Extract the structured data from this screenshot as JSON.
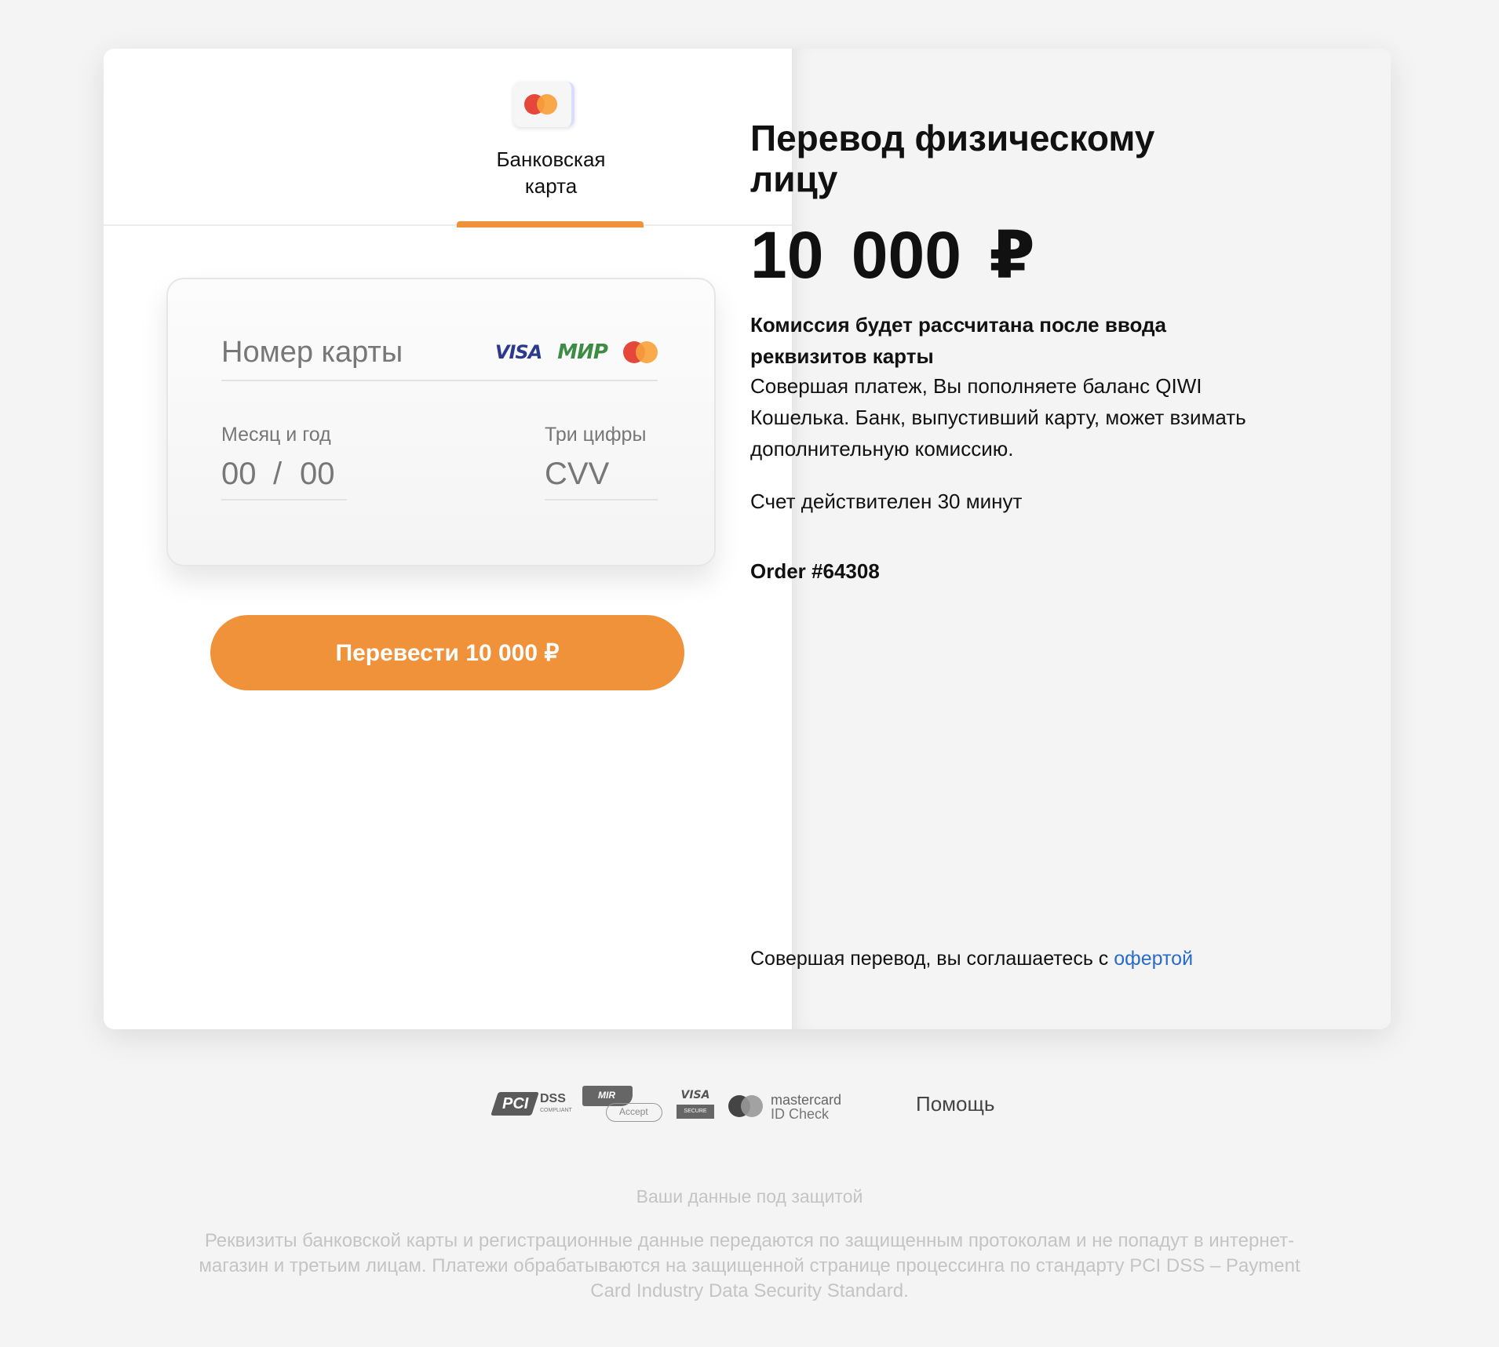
{
  "tab": {
    "label": "Банковская карта",
    "icon": "mastercard-icon"
  },
  "card_form": {
    "number_placeholder": "Номер карты",
    "brands": {
      "visa": "VISA",
      "mir": "МИР"
    },
    "expiry_label": "Месяц и год",
    "expiry_month": "00",
    "expiry_sep": "/",
    "expiry_year": "00",
    "cvv_label": "Три цифры",
    "cvv_placeholder": "CVV"
  },
  "pay_button": "Перевести 10  000 ₽",
  "summary": {
    "title": "Перевод физическому лицу",
    "amount": "10  000 ₽",
    "commission": "Комиссия будет рассчитана после ввода реквизитов карты",
    "description": "Совершая платеж, Вы пополняете баланс QIWI Кошелька. Банк, выпустивший карту, может взимать дополнительную комиссию.",
    "validity": "Счет действителен 30 минут",
    "order": "Order #64308",
    "agree_text": "Совершая перевод, вы соглашаетесь с ",
    "agree_link": "офертой"
  },
  "footer": {
    "pci": {
      "main": "PCI",
      "dss": "DSS",
      "compliant": "COMPLIANT"
    },
    "mir_accept": {
      "tag": "MIR",
      "accept": "Accept"
    },
    "visa_secure": {
      "visa": "VISA",
      "secure": "SECURE"
    },
    "mc_id": {
      "line1": "mastercard",
      "line2": "ID Check"
    },
    "help": "Помощь",
    "security_title": "Ваши данные под защитой",
    "security_text": "Реквизиты банковской карты и регистрационные данные передаются по защищенным протоколам и не попадут в интернет-магазин и третьим лицам. Платежи обрабатываются на защищенной странице процессинга по стандарту PCI DSS – Payment Card Industry Data Security Standard."
  },
  "colors": {
    "accent": "#f0923a",
    "link": "#2a6bc9",
    "background": "#f4f4f4"
  }
}
